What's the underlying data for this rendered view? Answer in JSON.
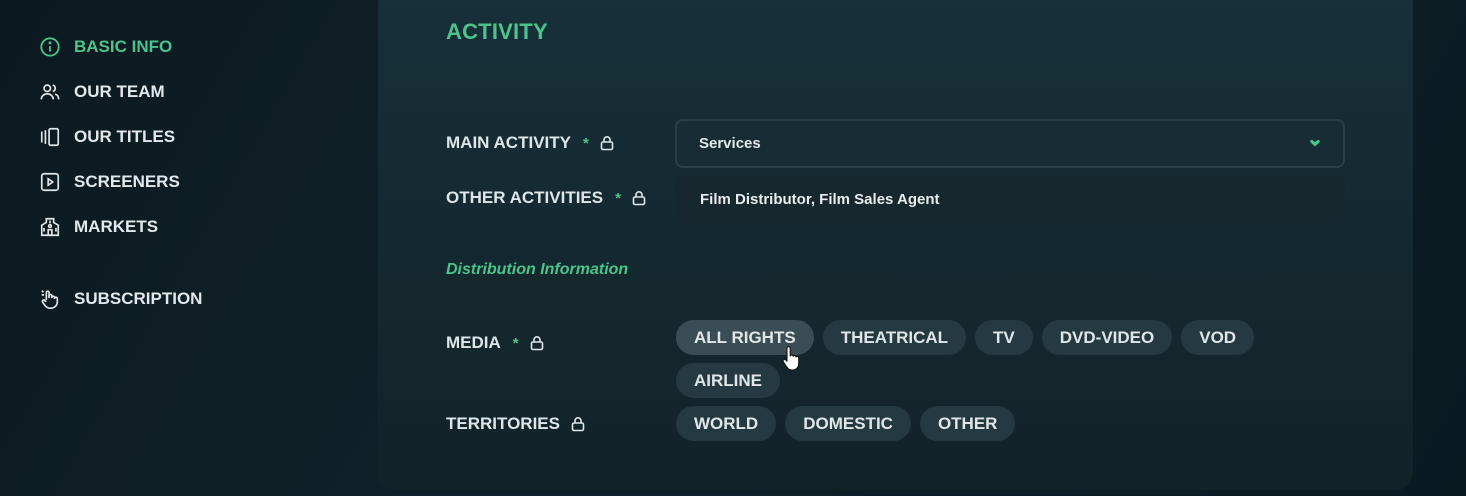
{
  "sidebar": {
    "items": [
      {
        "label": "BASIC INFO",
        "icon": "info-icon",
        "active": true
      },
      {
        "label": "OUR TEAM",
        "icon": "team-icon"
      },
      {
        "label": "OUR TITLES",
        "icon": "titles-icon"
      },
      {
        "label": "SCREENERS",
        "icon": "play-icon"
      },
      {
        "label": "MARKETS",
        "icon": "markets-icon"
      },
      {
        "label": "SUBSCRIPTION",
        "icon": "hand-icon"
      }
    ]
  },
  "activity": {
    "title": "ACTIVITY",
    "main_activity": {
      "label": "MAIN ACTIVITY",
      "required": "*",
      "value": "Services"
    },
    "other_activities": {
      "label": "OTHER ACTIVITIES",
      "required": "*",
      "value": "Film Distributor, Film Sales Agent"
    },
    "distribution_title": "Distribution Information",
    "media": {
      "label": "MEDIA",
      "required": "*",
      "options_row1": [
        "ALL RIGHTS",
        "THEATRICAL",
        "TV",
        "DVD-VIDEO",
        "VOD"
      ],
      "options_row2": [
        "AIRLINE"
      ]
    },
    "territories": {
      "label": "TERRITORIES",
      "options": [
        "WORLD",
        "DOMESTIC",
        "OTHER"
      ]
    }
  },
  "colors": {
    "accent": "#4cc38a",
    "panel": "#14292f",
    "chip": "#253941"
  }
}
